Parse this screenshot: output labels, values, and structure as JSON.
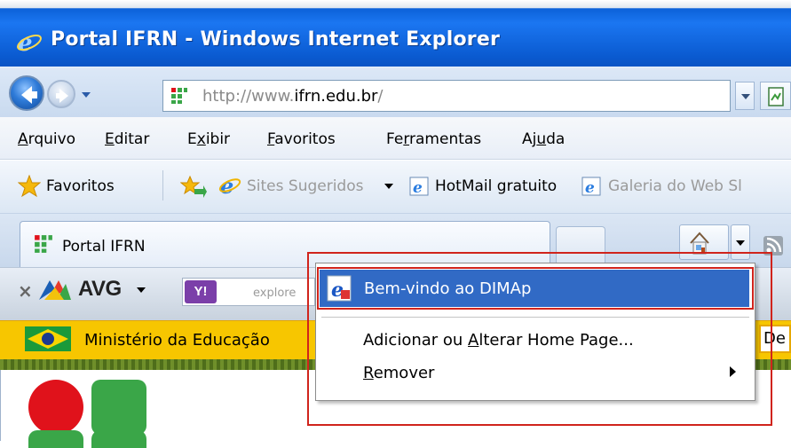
{
  "window": {
    "title": "Portal IFRN - Windows Internet Explorer"
  },
  "navigation": {
    "url_prefix": "http://www.",
    "url_domain": "ifrn.edu.br",
    "url_suffix": "/"
  },
  "menu": {
    "items": [
      {
        "label": "Arquivo",
        "u": "A",
        "rest": "rquivo"
      },
      {
        "label": "Editar",
        "u": "E",
        "rest": "ditar"
      },
      {
        "label": "Exibir",
        "pre": "E",
        "u": "x",
        "rest": "ibir"
      },
      {
        "label": "Favoritos",
        "u": "F",
        "rest": "avoritos"
      },
      {
        "label": "Ferramentas",
        "pre": "Fe",
        "u": "r",
        "rest": "ramentas"
      },
      {
        "label": "Ajuda",
        "pre": "Aj",
        "u": "u",
        "rest": "da"
      }
    ]
  },
  "favorites_bar": {
    "favorites_label": "Favoritos",
    "sites_label": "Sites Sugeridos",
    "hotmail_label": "HotMail gratuito",
    "gallery_label": "Galeria do Web Sl"
  },
  "tabs": {
    "active_label": "Portal IFRN"
  },
  "toolbar": {
    "avg_label": "AVG",
    "yahoo_label": "Y!",
    "search_placeholder": "explore"
  },
  "gov_bar": {
    "label": "Ministério da Educação",
    "search_partial": "De"
  },
  "context_menu": {
    "highlighted": "Bem-vindo ao DIMAp",
    "items": [
      {
        "pre": "Adicionar ou ",
        "u": "A",
        "rest": "lterar Home Page..."
      },
      {
        "pre": "",
        "u": "R",
        "rest": "emover"
      }
    ]
  },
  "colors": {
    "titlebar": "#0a5ad0",
    "highlight": "#316ac5",
    "annotation_red": "#d0241c",
    "gov_yellow": "#f7c600"
  }
}
